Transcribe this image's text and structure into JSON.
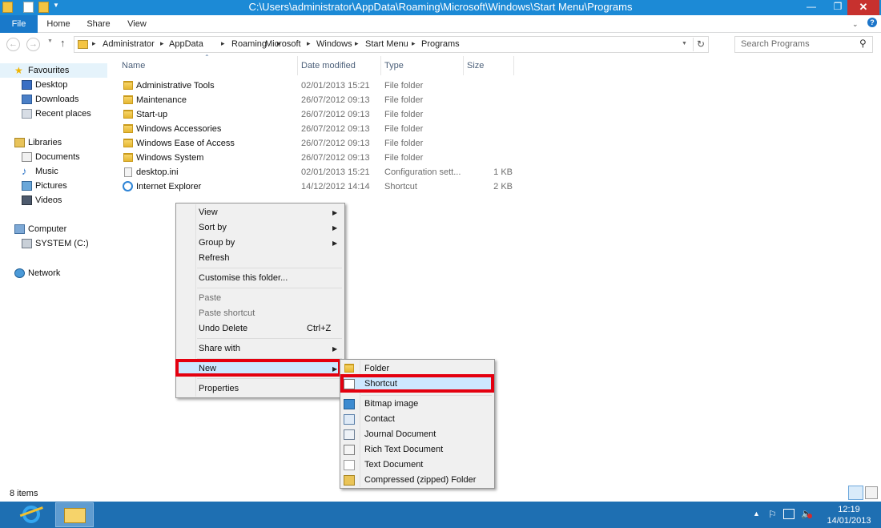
{
  "window": {
    "title": "C:\\Users\\administrator\\AppData\\Roaming\\Microsoft\\Windows\\Start Menu\\Programs",
    "minimize": "—",
    "maximize": "❐",
    "close": "✕"
  },
  "ribbon": {
    "tabs": [
      "File",
      "Home",
      "Share",
      "View"
    ]
  },
  "address": {
    "crumbs": [
      "Administrator",
      "AppData",
      "Roaming",
      "Microsoft",
      "Windows",
      "Start Menu",
      "Programs"
    ],
    "search_placeholder": "Search Programs"
  },
  "nav": {
    "favourites": "Favourites",
    "fav_items": [
      "Desktop",
      "Downloads",
      "Recent places"
    ],
    "libraries": "Libraries",
    "lib_items": [
      "Documents",
      "Music",
      "Pictures",
      "Videos"
    ],
    "computer": "Computer",
    "computer_items": [
      "SYSTEM (C:)"
    ],
    "network": "Network"
  },
  "columns": [
    "Name",
    "Date modified",
    "Type",
    "Size"
  ],
  "files": [
    {
      "name": "Administrative Tools",
      "date": "02/01/2013 15:21",
      "type": "File folder",
      "size": "",
      "icon": "folder-icon"
    },
    {
      "name": "Maintenance",
      "date": "26/07/2012 09:13",
      "type": "File folder",
      "size": "",
      "icon": "folder-icon"
    },
    {
      "name": "Start-up",
      "date": "26/07/2012 09:13",
      "type": "File folder",
      "size": "",
      "icon": "folder-icon"
    },
    {
      "name": "Windows Accessories",
      "date": "26/07/2012 09:13",
      "type": "File folder",
      "size": "",
      "icon": "folder-icon"
    },
    {
      "name": "Windows Ease of Access",
      "date": "26/07/2012 09:13",
      "type": "File folder",
      "size": "",
      "icon": "folder-icon"
    },
    {
      "name": "Windows System",
      "date": "26/07/2012 09:13",
      "type": "File folder",
      "size": "",
      "icon": "folder-icon"
    },
    {
      "name": "desktop.ini",
      "date": "02/01/2013 15:21",
      "type": "Configuration sett...",
      "size": "1 KB",
      "icon": "ini-file-icon"
    },
    {
      "name": "Internet Explorer",
      "date": "14/12/2012 14:14",
      "type": "Shortcut",
      "size": "2 KB",
      "icon": "ie-shortcut-icon"
    }
  ],
  "context_menu": {
    "view": "View",
    "sort_by": "Sort by",
    "group_by": "Group by",
    "refresh": "Refresh",
    "customise": "Customise this folder...",
    "paste": "Paste",
    "paste_shortcut": "Paste shortcut",
    "undo_delete": "Undo Delete",
    "undo_shortcut": "Ctrl+Z",
    "share_with": "Share with",
    "new": "New",
    "properties": "Properties"
  },
  "new_submenu": {
    "folder": "Folder",
    "shortcut": "Shortcut",
    "bitmap": "Bitmap image",
    "contact": "Contact",
    "journal": "Journal Document",
    "rtf": "Rich Text Document",
    "text": "Text Document",
    "zip": "Compressed (zipped) Folder"
  },
  "status": {
    "items": "8 items"
  },
  "taskbar": {
    "time": "12:19",
    "date": "14/01/2013"
  },
  "colors": {
    "titlebar": "#1c8ad6",
    "highlight": "#e4000f",
    "taskbar": "#1e6fb2"
  }
}
